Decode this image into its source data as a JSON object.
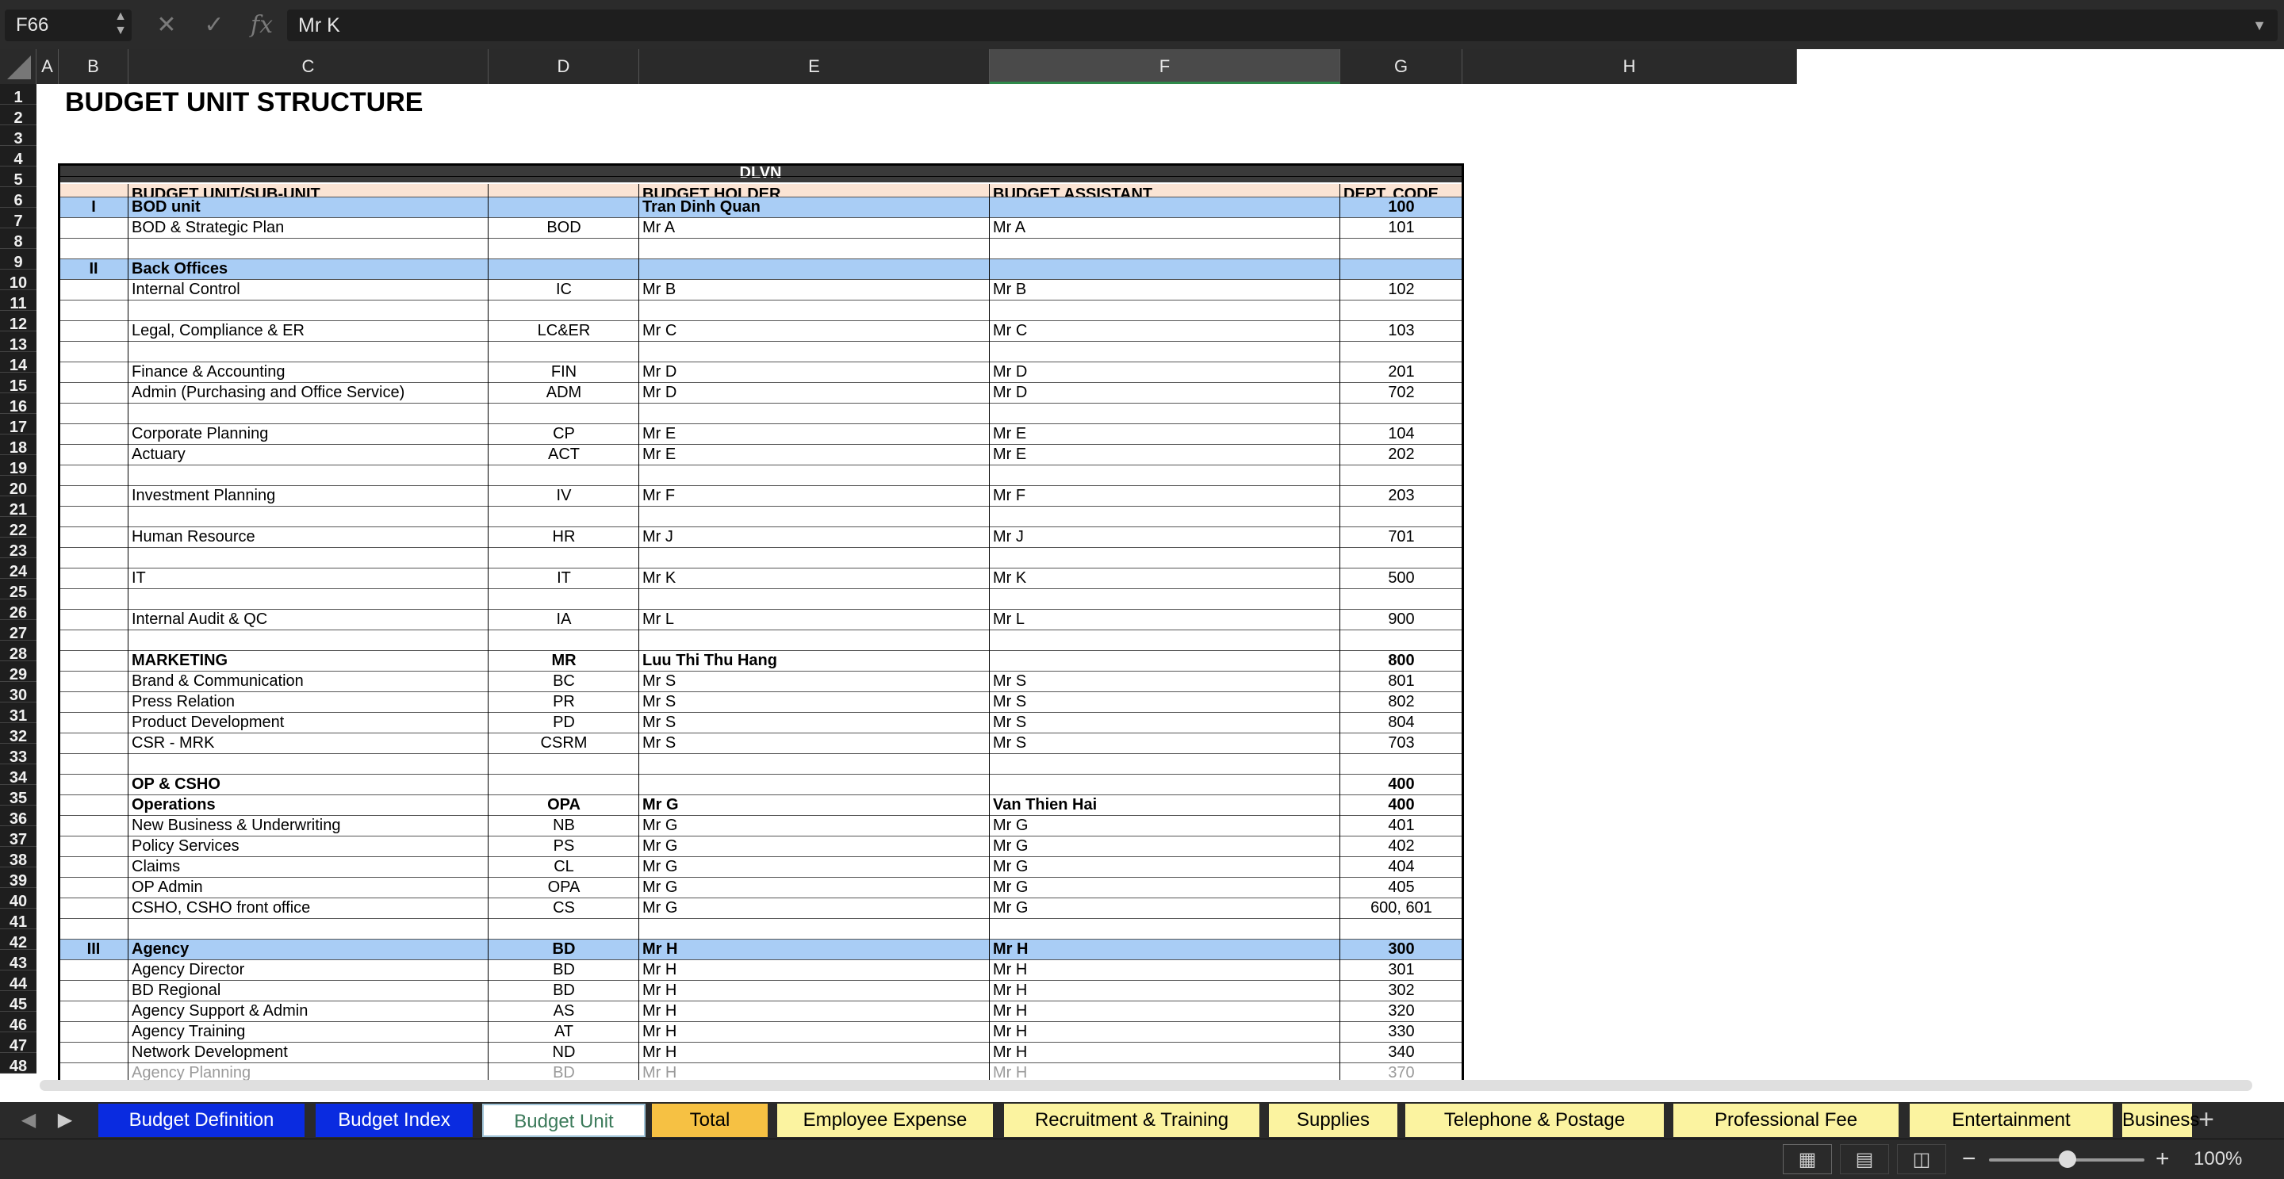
{
  "formula_bar": {
    "cell_ref": "F66",
    "content": "Mr K"
  },
  "columns": [
    "A",
    "B",
    "C",
    "D",
    "E",
    "F",
    "G",
    "H"
  ],
  "selected_column": "F",
  "sheet": {
    "title": "BUDGET UNIT STRUCTURE",
    "group_header": "DLVN",
    "headers": {
      "unit": "BUDGET UNIT/SUB-UNIT",
      "holder": "BUDGET HOLDER",
      "assistant": "BUDGET ASSISTANT",
      "code": "DEPT. CODE"
    },
    "row_numbers": [
      "1",
      "2",
      "3",
      "4",
      "5",
      "6",
      "7",
      "8",
      "9",
      "10",
      "11",
      "12",
      "13",
      "14",
      "15",
      "16",
      "17",
      "18",
      "19",
      "20",
      "21",
      "22",
      "23",
      "24",
      "25",
      "26",
      "27",
      "28",
      "29",
      "30",
      "31",
      "32",
      "33",
      "34",
      "35",
      "36",
      "37",
      "38",
      "39",
      "40",
      "41",
      "42",
      "43",
      "44",
      "45",
      "46",
      "47",
      "48"
    ],
    "rows": [
      {
        "row": 6,
        "b": "I",
        "c": "BOD unit",
        "d": "",
        "e": "Tran Dinh Quan",
        "f": "",
        "g": "100",
        "style": "blue"
      },
      {
        "row": 7,
        "b": "",
        "c": "BOD & Strategic Plan",
        "d": "BOD",
        "e": "Mr A",
        "f": "Mr A",
        "g": "101"
      },
      {
        "row": 9,
        "b": "II",
        "c": "Back Offices",
        "d": "",
        "e": "",
        "f": "",
        "g": "",
        "style": "blue"
      },
      {
        "row": 10,
        "b": "",
        "c": "Internal Control",
        "d": "IC",
        "e": "Mr B",
        "f": "Mr B",
        "g": "102"
      },
      {
        "row": 12,
        "b": "",
        "c": "Legal, Compliance & ER",
        "d": "LC&ER",
        "e": "Mr C",
        "f": "Mr C",
        "g": "103"
      },
      {
        "row": 14,
        "b": "",
        "c": "Finance & Accounting",
        "d": "FIN",
        "e": "Mr D",
        "f": "Mr D",
        "g": "201"
      },
      {
        "row": 15,
        "b": "",
        "c": "Admin (Purchasing and Office Service)",
        "d": "ADM",
        "e": "Mr D",
        "f": "Mr D",
        "g": "702"
      },
      {
        "row": 17,
        "b": "",
        "c": "Corporate Planning",
        "d": "CP",
        "e": "Mr E",
        "f": "Mr E",
        "g": "104"
      },
      {
        "row": 18,
        "b": "",
        "c": "Actuary",
        "d": "ACT",
        "e": "Mr E",
        "f": "Mr E",
        "g": "202"
      },
      {
        "row": 20,
        "b": "",
        "c": "Investment Planning",
        "d": "IV",
        "e": "Mr F",
        "f": "Mr F",
        "g": "203"
      },
      {
        "row": 22,
        "b": "",
        "c": "Human Resource",
        "d": "HR",
        "e": "Mr J",
        "f": "Mr J",
        "g": "701"
      },
      {
        "row": 24,
        "b": "",
        "c": "IT",
        "d": "IT",
        "e": "Mr K",
        "f": "Mr K",
        "g": "500"
      },
      {
        "row": 26,
        "b": "",
        "c": "Internal Audit & QC",
        "d": "IA",
        "e": "Mr L",
        "f": "Mr L",
        "g": "900"
      },
      {
        "row": 28,
        "b": "",
        "c": "MARKETING",
        "d": "MR",
        "e": "Luu Thi Thu Hang",
        "f": "",
        "g": "800",
        "style": "bold"
      },
      {
        "row": 29,
        "b": "",
        "c": "Brand & Communication",
        "d": "BC",
        "e": "Mr S",
        "f": "Mr S",
        "g": "801"
      },
      {
        "row": 30,
        "b": "",
        "c": "Press Relation",
        "d": "PR",
        "e": "Mr S",
        "f": "Mr S",
        "g": "802"
      },
      {
        "row": 31,
        "b": "",
        "c": "Product Development",
        "d": "PD",
        "e": "Mr S",
        "f": "Mr S",
        "g": "804"
      },
      {
        "row": 32,
        "b": "",
        "c": "CSR - MRK",
        "d": "CSRM",
        "e": "Mr S",
        "f": "Mr S",
        "g": "703"
      },
      {
        "row": 34,
        "b": "",
        "c": "OP & CSHO",
        "d": "",
        "e": "",
        "f": "",
        "g": "400",
        "style": "bold"
      },
      {
        "row": 35,
        "b": "",
        "c": "Operations",
        "d": "OPA",
        "e": "Mr G",
        "f": "Van Thien Hai",
        "g": "400",
        "style": "bold"
      },
      {
        "row": 36,
        "b": "",
        "c": "New Business & Underwriting",
        "d": "NB",
        "e": "Mr G",
        "f": "Mr G",
        "g": "401"
      },
      {
        "row": 37,
        "b": "",
        "c": "Policy Services",
        "d": "PS",
        "e": "Mr G",
        "f": "Mr G",
        "g": "402"
      },
      {
        "row": 38,
        "b": "",
        "c": "Claims",
        "d": "CL",
        "e": "Mr G",
        "f": "Mr G",
        "g": "404"
      },
      {
        "row": 39,
        "b": "",
        "c": "OP Admin",
        "d": "OPA",
        "e": "Mr G",
        "f": "Mr G",
        "g": "405"
      },
      {
        "row": 40,
        "b": "",
        "c": "CSHO, CSHO front office",
        "d": "CS",
        "e": "Mr G",
        "f": "Mr G",
        "g": "600, 601"
      },
      {
        "row": 42,
        "b": "III",
        "c": "Agency",
        "d": "BD",
        "e": "Mr H",
        "f": "Mr H",
        "g": "300",
        "style": "blue"
      },
      {
        "row": 43,
        "b": "",
        "c": "Agency Director",
        "d": "BD",
        "e": "Mr H",
        "f": "Mr H",
        "g": "301"
      },
      {
        "row": 44,
        "b": "",
        "c": "BD Regional",
        "d": "BD",
        "e": "Mr H",
        "f": "Mr H",
        "g": "302"
      },
      {
        "row": 45,
        "b": "",
        "c": "Agency Support & Admin",
        "d": "AS",
        "e": "Mr H",
        "f": "Mr H",
        "g": "320"
      },
      {
        "row": 46,
        "b": "",
        "c": "Agency Training",
        "d": "AT",
        "e": "Mr H",
        "f": "Mr H",
        "g": "330"
      },
      {
        "row": 47,
        "b": "",
        "c": "Network Development",
        "d": "ND",
        "e": "Mr H",
        "f": "Mr H",
        "g": "340"
      },
      {
        "row": 48,
        "b": "",
        "c": "Agency Planning",
        "d": "BD",
        "e": "Mr H",
        "f": "Mr H",
        "g": "370"
      }
    ]
  },
  "tabs": [
    {
      "label": "Budget Definition",
      "bg": "#0a2be0",
      "fg": "#ffffff"
    },
    {
      "label": "Budget Index",
      "bg": "#0a2be0",
      "fg": "#ffffff"
    },
    {
      "label": "Budget Unit",
      "bg": "#ffffff",
      "fg": "#3b7a5a",
      "active": true
    },
    {
      "label": "Total",
      "bg": "#f6c143",
      "fg": "#000000"
    },
    {
      "label": "Employee Expense",
      "bg": "#fbf3a0",
      "fg": "#000000"
    },
    {
      "label": "Recruitment & Training",
      "bg": "#fbf3a0",
      "fg": "#000000"
    },
    {
      "label": "Supplies",
      "bg": "#fbf3a0",
      "fg": "#000000"
    },
    {
      "label": "Telephone & Postage",
      "bg": "#fbf3a0",
      "fg": "#000000"
    },
    {
      "label": "Professional Fee",
      "bg": "#fbf3a0",
      "fg": "#000000"
    },
    {
      "label": "Entertainment",
      "bg": "#fbf3a0",
      "fg": "#000000"
    },
    {
      "label": "Business Tra",
      "bg": "#fbf3a0",
      "fg": "#000000"
    }
  ],
  "status": {
    "zoom": "100%"
  }
}
